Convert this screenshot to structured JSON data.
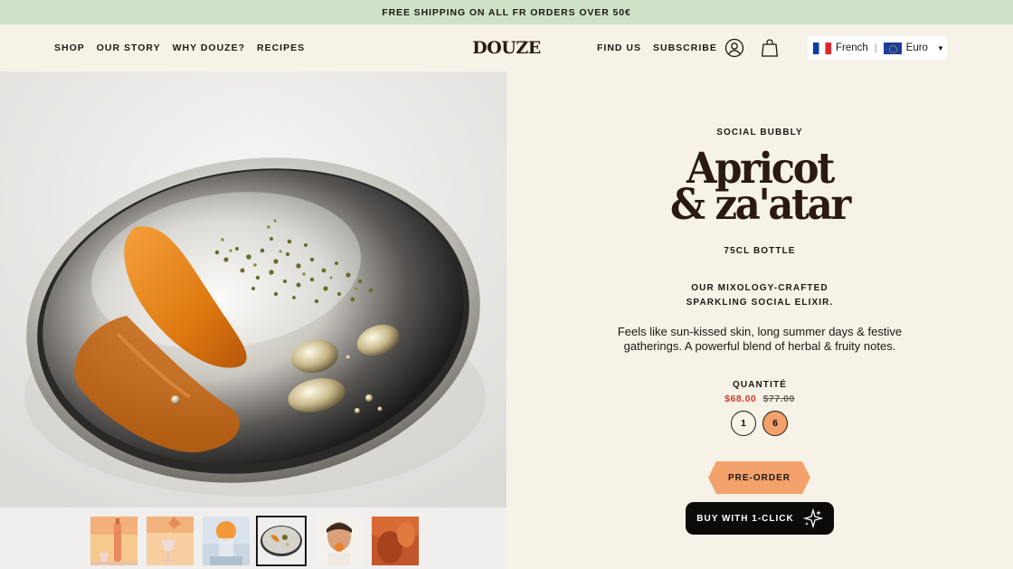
{
  "announcement": "FREE SHIPPING ON ALL FR ORDERS OVER 50€",
  "nav": {
    "left": [
      "SHOP",
      "OUR STORY",
      "WHY DOUZE?",
      "RECIPES"
    ],
    "logo": "DOUZE",
    "right": [
      "FIND US",
      "SUBSCRIBE"
    ]
  },
  "icons": {
    "account": "user-icon",
    "cart": "bag-icon"
  },
  "locale": {
    "language": "French",
    "currency": "Euro"
  },
  "product": {
    "eyebrow": "SOCIAL BUBBLY",
    "title_line1": "Apricot",
    "title_line2": "& za'atar",
    "size": "75CL BOTTLE",
    "tagline_line1": "OUR MIXOLOGY-CRAFTED",
    "tagline_line2": "SPARKLING SOCIAL ELIXIR.",
    "description": "Feels like sun-kissed skin, long summer days & festive gatherings. A powerful blend of herbal & fruity notes.",
    "quantity_label": "QUANTITÉ",
    "price_sale": "$68.00",
    "price_old": "$77.00",
    "quantity_options": [
      "1",
      "6"
    ],
    "selected_quantity": "6",
    "preorder_label": "PRE-ORDER",
    "buy_label": "BUY WITH 1-CLICK"
  },
  "colors": {
    "announcement_bg": "#cfe2c8",
    "page_bg": "#f6f2e7",
    "accent": "#f2a26a",
    "sale_price": "#d13a28",
    "dark_button": "#0d0b0a"
  },
  "gallery": {
    "thumbnails": [
      "bottle-thumbnail",
      "pouring-thumbnail",
      "glass-thumbnail",
      "plate-thumbnail",
      "woman-thumbnail",
      "apricot-thumbnail"
    ],
    "active_index": 3
  }
}
